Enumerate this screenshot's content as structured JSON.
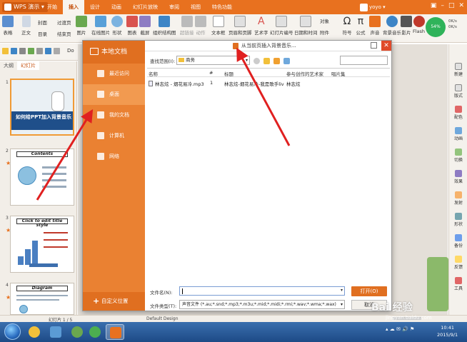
{
  "titlebar": {
    "app_name": "WPS 演示",
    "tabs": [
      "开始",
      "插入",
      "设计",
      "动画",
      "幻灯片放映",
      "审阅",
      "视图",
      "特色功能"
    ],
    "active_tab": "插入",
    "user": "yoyo",
    "accent": "#e8711f"
  },
  "ribbon": {
    "items": [
      "表格",
      "正文",
      "封面",
      "目录",
      "过渡页",
      "结束页",
      "图片",
      "在线图片",
      "形状",
      "图表",
      "截屏",
      "组织结构图",
      "超链接",
      "动作",
      "文本框",
      "页眉和页脚",
      "艺术字",
      "幻灯片编号",
      "日期和时间",
      "对象",
      "附件",
      "符号",
      "公式",
      "声音",
      "背景音乐",
      "影片",
      "Flash"
    ],
    "net_percent": "54%",
    "net_up": "0K/s",
    "net_down": "0K/s"
  },
  "quickbar": {
    "doc_tab": "Do"
  },
  "leftpanel": {
    "tabs": [
      "大纲",
      "幻灯片"
    ],
    "active_tab": "幻灯片",
    "slides": [
      {
        "num": "1",
        "title": "如何给PPT加入背景音乐"
      },
      {
        "num": "2",
        "title": "Contents"
      },
      {
        "num": "3",
        "title": "Click to edit title style"
      },
      {
        "num": "4",
        "title": "Diagram"
      }
    ]
  },
  "dialog": {
    "title": "从当前页插入背景音乐...",
    "sidebar": {
      "header": "本地文档",
      "items": [
        "最近访问",
        "桌面",
        "我的文档",
        "计算机",
        "网络"
      ],
      "custom_position": "自定义位置"
    },
    "look_in_label": "查找范围(I):",
    "look_in_value": "商务",
    "columns": [
      "名称",
      "#",
      "标题",
      "参与创作的艺术家",
      "唱片集"
    ],
    "files": [
      {
        "name": "林志炫 - 烟花易冷.mp3",
        "num": "1",
        "title": "林志炫-烟花易冷-我是歌手live...",
        "artist": "林志炫",
        "album": ""
      }
    ],
    "filename_label": "文件名(N):",
    "filename_value": "",
    "filetype_label": "文件类型(T):",
    "filetype_value": "声音文件 (*.au;*.snd;*.mp3;*.m3u;*.mid;*.midi;*.rmi;*.wav;*.wma;*.wax)",
    "open_label": "打开(O)",
    "cancel_label": "取消"
  },
  "rightpanel": {
    "items": [
      "新建",
      "版式",
      "配色",
      "动画",
      "切换",
      "效果",
      "发射",
      "形状",
      "备份",
      "反馈",
      "工具"
    ]
  },
  "statusbar": {
    "slide_info": "幻灯片 1 / 5",
    "design": "Default Design"
  },
  "taskbar": {
    "time": "10:41",
    "date": "2015/9/1"
  },
  "watermark": {
    "text": "Bai 经验",
    "url": "jingyan.baidu.com"
  }
}
